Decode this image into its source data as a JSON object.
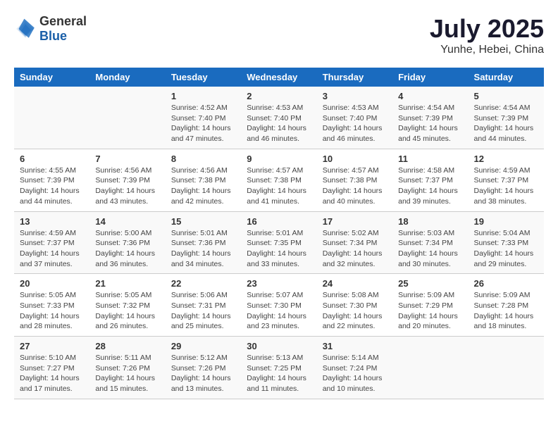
{
  "header": {
    "logo_general": "General",
    "logo_blue": "Blue",
    "month_year": "July 2025",
    "location": "Yunhe, Hebei, China"
  },
  "weekdays": [
    "Sunday",
    "Monday",
    "Tuesday",
    "Wednesday",
    "Thursday",
    "Friday",
    "Saturday"
  ],
  "weeks": [
    [
      {
        "day": "",
        "info": ""
      },
      {
        "day": "",
        "info": ""
      },
      {
        "day": "1",
        "info": "Sunrise: 4:52 AM\nSunset: 7:40 PM\nDaylight: 14 hours and 47 minutes."
      },
      {
        "day": "2",
        "info": "Sunrise: 4:53 AM\nSunset: 7:40 PM\nDaylight: 14 hours and 46 minutes."
      },
      {
        "day": "3",
        "info": "Sunrise: 4:53 AM\nSunset: 7:40 PM\nDaylight: 14 hours and 46 minutes."
      },
      {
        "day": "4",
        "info": "Sunrise: 4:54 AM\nSunset: 7:39 PM\nDaylight: 14 hours and 45 minutes."
      },
      {
        "day": "5",
        "info": "Sunrise: 4:54 AM\nSunset: 7:39 PM\nDaylight: 14 hours and 44 minutes."
      }
    ],
    [
      {
        "day": "6",
        "info": "Sunrise: 4:55 AM\nSunset: 7:39 PM\nDaylight: 14 hours and 44 minutes."
      },
      {
        "day": "7",
        "info": "Sunrise: 4:56 AM\nSunset: 7:39 PM\nDaylight: 14 hours and 43 minutes."
      },
      {
        "day": "8",
        "info": "Sunrise: 4:56 AM\nSunset: 7:38 PM\nDaylight: 14 hours and 42 minutes."
      },
      {
        "day": "9",
        "info": "Sunrise: 4:57 AM\nSunset: 7:38 PM\nDaylight: 14 hours and 41 minutes."
      },
      {
        "day": "10",
        "info": "Sunrise: 4:57 AM\nSunset: 7:38 PM\nDaylight: 14 hours and 40 minutes."
      },
      {
        "day": "11",
        "info": "Sunrise: 4:58 AM\nSunset: 7:37 PM\nDaylight: 14 hours and 39 minutes."
      },
      {
        "day": "12",
        "info": "Sunrise: 4:59 AM\nSunset: 7:37 PM\nDaylight: 14 hours and 38 minutes."
      }
    ],
    [
      {
        "day": "13",
        "info": "Sunrise: 4:59 AM\nSunset: 7:37 PM\nDaylight: 14 hours and 37 minutes."
      },
      {
        "day": "14",
        "info": "Sunrise: 5:00 AM\nSunset: 7:36 PM\nDaylight: 14 hours and 36 minutes."
      },
      {
        "day": "15",
        "info": "Sunrise: 5:01 AM\nSunset: 7:36 PM\nDaylight: 14 hours and 34 minutes."
      },
      {
        "day": "16",
        "info": "Sunrise: 5:01 AM\nSunset: 7:35 PM\nDaylight: 14 hours and 33 minutes."
      },
      {
        "day": "17",
        "info": "Sunrise: 5:02 AM\nSunset: 7:34 PM\nDaylight: 14 hours and 32 minutes."
      },
      {
        "day": "18",
        "info": "Sunrise: 5:03 AM\nSunset: 7:34 PM\nDaylight: 14 hours and 30 minutes."
      },
      {
        "day": "19",
        "info": "Sunrise: 5:04 AM\nSunset: 7:33 PM\nDaylight: 14 hours and 29 minutes."
      }
    ],
    [
      {
        "day": "20",
        "info": "Sunrise: 5:05 AM\nSunset: 7:33 PM\nDaylight: 14 hours and 28 minutes."
      },
      {
        "day": "21",
        "info": "Sunrise: 5:05 AM\nSunset: 7:32 PM\nDaylight: 14 hours and 26 minutes."
      },
      {
        "day": "22",
        "info": "Sunrise: 5:06 AM\nSunset: 7:31 PM\nDaylight: 14 hours and 25 minutes."
      },
      {
        "day": "23",
        "info": "Sunrise: 5:07 AM\nSunset: 7:30 PM\nDaylight: 14 hours and 23 minutes."
      },
      {
        "day": "24",
        "info": "Sunrise: 5:08 AM\nSunset: 7:30 PM\nDaylight: 14 hours and 22 minutes."
      },
      {
        "day": "25",
        "info": "Sunrise: 5:09 AM\nSunset: 7:29 PM\nDaylight: 14 hours and 20 minutes."
      },
      {
        "day": "26",
        "info": "Sunrise: 5:09 AM\nSunset: 7:28 PM\nDaylight: 14 hours and 18 minutes."
      }
    ],
    [
      {
        "day": "27",
        "info": "Sunrise: 5:10 AM\nSunset: 7:27 PM\nDaylight: 14 hours and 17 minutes."
      },
      {
        "day": "28",
        "info": "Sunrise: 5:11 AM\nSunset: 7:26 PM\nDaylight: 14 hours and 15 minutes."
      },
      {
        "day": "29",
        "info": "Sunrise: 5:12 AM\nSunset: 7:26 PM\nDaylight: 14 hours and 13 minutes."
      },
      {
        "day": "30",
        "info": "Sunrise: 5:13 AM\nSunset: 7:25 PM\nDaylight: 14 hours and 11 minutes."
      },
      {
        "day": "31",
        "info": "Sunrise: 5:14 AM\nSunset: 7:24 PM\nDaylight: 14 hours and 10 minutes."
      },
      {
        "day": "",
        "info": ""
      },
      {
        "day": "",
        "info": ""
      }
    ]
  ]
}
